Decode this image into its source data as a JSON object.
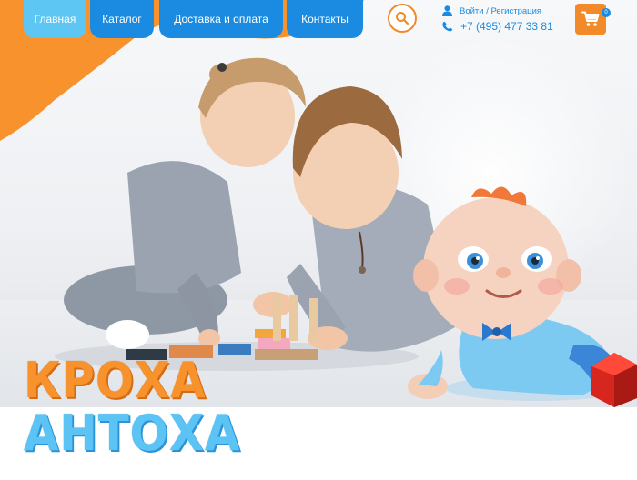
{
  "nav": {
    "items": [
      {
        "label": "Главная",
        "active": true
      },
      {
        "label": "Каталог",
        "active": false
      },
      {
        "label": "Доставка и оплата",
        "active": false
      },
      {
        "label": "Контакты",
        "active": false
      }
    ]
  },
  "header": {
    "login_label": "Войти / Регистрация",
    "phone": "+7 (495) 477 33 81",
    "cart_count": "0"
  },
  "hero": {
    "title_line1": "КРОХА",
    "title_line2": "АНТОХА"
  },
  "colors": {
    "orange": "#f28a2a",
    "blue": "#1a8be0",
    "light_blue": "#5ec6f3"
  },
  "icons": [
    "search-icon",
    "user-icon",
    "phone-icon",
    "cart-icon"
  ]
}
